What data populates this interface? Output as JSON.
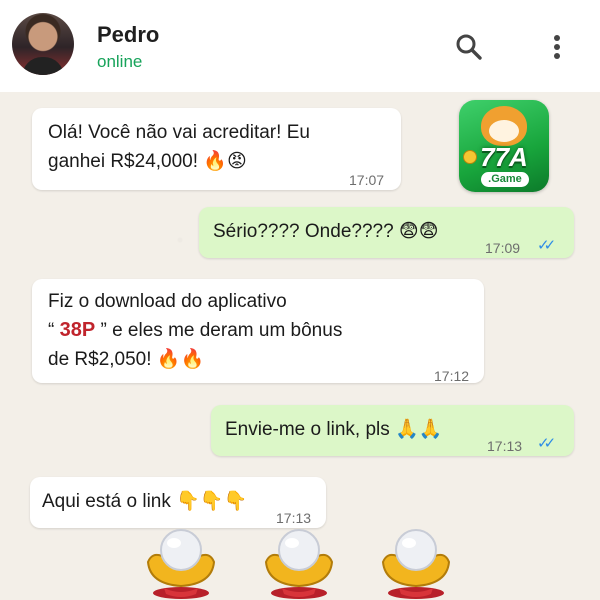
{
  "contact": {
    "name": "Pedro",
    "status": "online"
  },
  "header_icons": [
    "search-icon",
    "more-vert-icon"
  ],
  "messages": [
    {
      "direction": "incoming",
      "line1": "Olá! Você não vai acreditar! Eu",
      "line2": "ganhei R$24,000! 🔥😡",
      "time": "17:07"
    },
    {
      "direction": "outgoing",
      "text": "Sério???? Onde???? 😨😨",
      "time": "17:09",
      "read": true
    },
    {
      "direction": "incoming",
      "line1": "Fiz o download do aplicativo",
      "line2_pre": "“ ",
      "line2_highlight": "38P",
      "line2_post": " ” e eles me deram um bônus",
      "line3": "de R$2,050! 🔥🔥",
      "time": "17:12"
    },
    {
      "direction": "outgoing",
      "text": "Envie-me o link, pls 🙏🙏",
      "time": "17:13",
      "read": true
    },
    {
      "direction": "incoming",
      "text": "Aqui está o link 👇👇👇",
      "time": "17:13"
    }
  ],
  "app_logo": {
    "title": "77A",
    "subtitle": ".Game"
  },
  "treasure_icons": [
    "gold-ingot-icon",
    "gold-ingot-icon",
    "gold-ingot-icon"
  ],
  "colors": {
    "outgoing_bubble": "#dcf7c8",
    "incoming_bubble": "#ffffff",
    "online": "#17a35a",
    "read_ticks": "#2e8de6",
    "highlight": "#c0242c",
    "app_green": "#18a53c"
  }
}
